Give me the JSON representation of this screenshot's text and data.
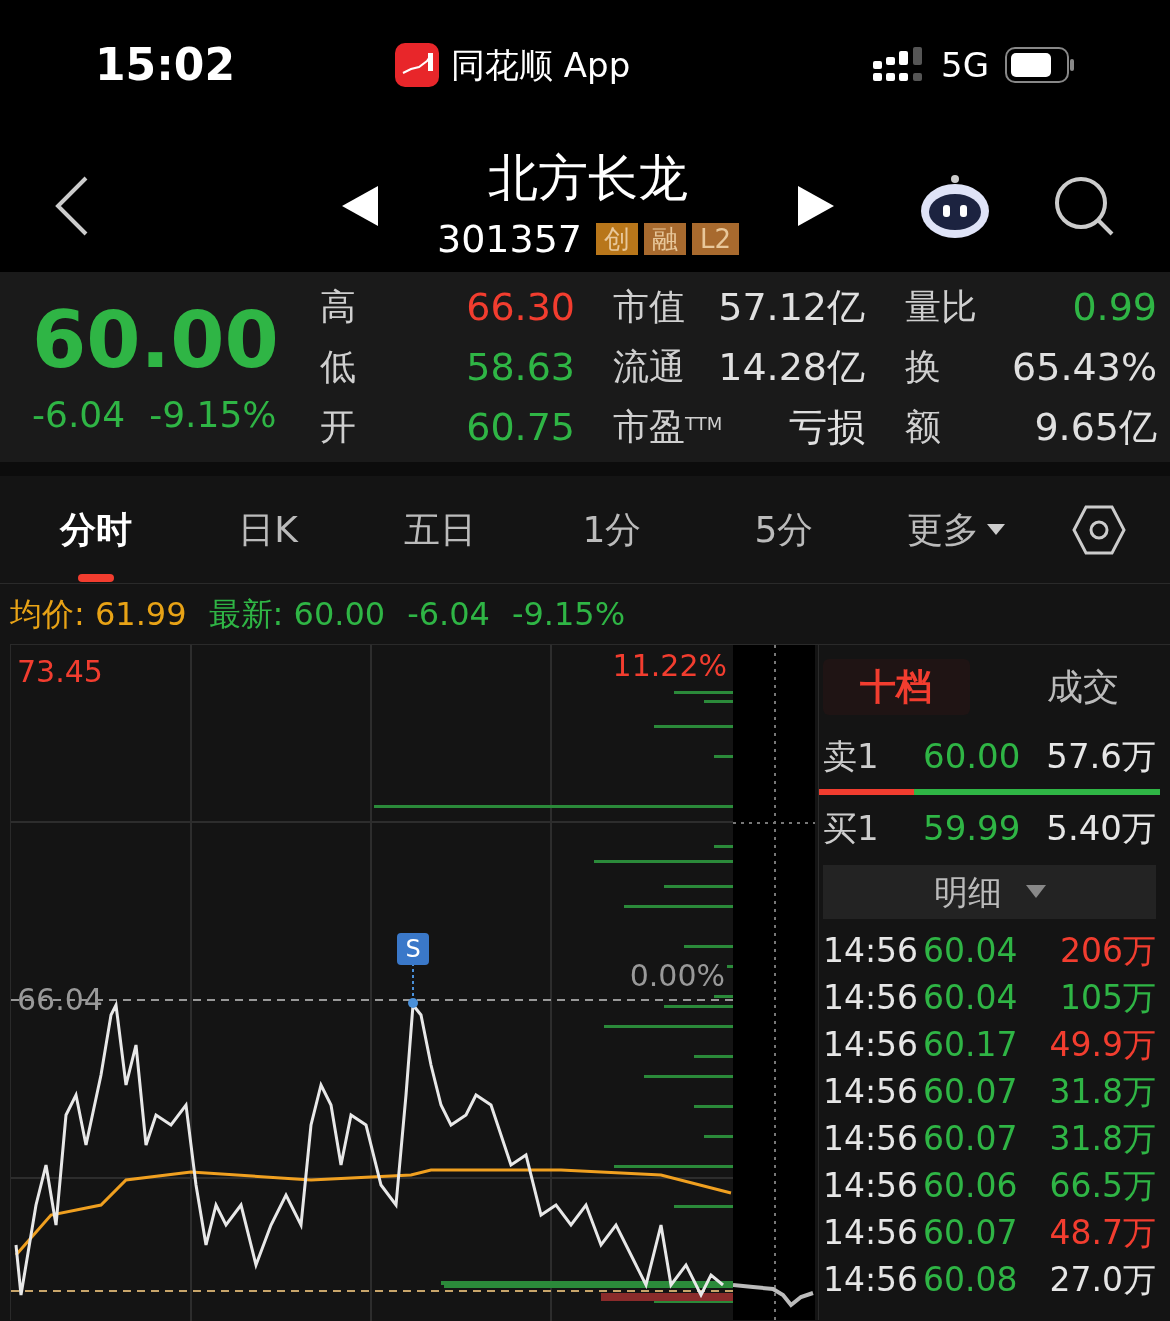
{
  "status_bar": {
    "time": "15:02",
    "app": "同花顺 App",
    "network": "5G"
  },
  "header": {
    "name": "北方长龙",
    "code": "301357",
    "tags": [
      {
        "label": "创",
        "color": "#b8761a"
      },
      {
        "label": "融",
        "color": "#a86a2e"
      },
      {
        "label": "L2",
        "color": "#a86a2e"
      }
    ]
  },
  "quote": {
    "price": "60.00",
    "change": "-6.04",
    "change_pct": "-9.15%",
    "stats": [
      [
        {
          "label": "高",
          "value": "66.30",
          "color": "#f23d2f"
        },
        {
          "label": "市值",
          "value": "57.12亿",
          "color": "#e0e0e0"
        },
        {
          "label": "量比",
          "value": "0.99",
          "color": "#2fb545"
        }
      ],
      [
        {
          "label": "低",
          "value": "58.63",
          "color": "#2fb545"
        },
        {
          "label": "流通",
          "value": "14.28亿",
          "color": "#e0e0e0"
        },
        {
          "label": "换",
          "value": "65.43%",
          "color": "#e0e0e0"
        }
      ],
      [
        {
          "label": "开",
          "value": "60.75",
          "color": "#2fb545"
        },
        {
          "label": "市盈$^{TTM}$",
          "value": "亏损",
          "color": "#e0e0e0"
        },
        {
          "label": "额",
          "value": "9.65亿",
          "color": "#e0e0e0"
        }
      ]
    ]
  },
  "tabs": [
    {
      "label": "分时",
      "selected": true,
      "kind": "tab"
    },
    {
      "label": "日K",
      "selected": false,
      "kind": "tab"
    },
    {
      "label": "五日",
      "selected": false,
      "kind": "tab"
    },
    {
      "label": "1分",
      "selected": false,
      "kind": "tab"
    },
    {
      "label": "5分",
      "selected": false,
      "kind": "tab"
    },
    {
      "label": "更多",
      "selected": false,
      "kind": "menu"
    }
  ],
  "info_line": {
    "avg_label": "均价: 61.99",
    "latest": "最新: 60.00",
    "change": "-6.04",
    "change_pct": "-9.15%"
  },
  "chart": {
    "top_price": "73.45",
    "top_pct": "11.22%",
    "mid_price": "66.04",
    "mid_pct": "0.00%",
    "marker": "S"
  },
  "order_book": {
    "tabs": [
      {
        "label": "十档",
        "selected": true
      },
      {
        "label": "成交",
        "selected": false
      }
    ],
    "levels": [
      {
        "side": "卖1",
        "price": "60.00",
        "volume": "57.6万"
      },
      {
        "side": "买1",
        "price": "59.99",
        "volume": "5.40万"
      }
    ],
    "detail_button": "明细",
    "trades": [
      {
        "time": "14:56",
        "price": "60.04",
        "volume": "206万",
        "color": "#f23d2f"
      },
      {
        "time": "14:56",
        "price": "60.04",
        "volume": "105万",
        "color": "#2fb545"
      },
      {
        "time": "14:56",
        "price": "60.17",
        "volume": "49.9万",
        "color": "#f23d2f"
      },
      {
        "time": "14:56",
        "price": "60.07",
        "volume": "31.8万",
        "color": "#2fb545"
      },
      {
        "time": "14:56",
        "price": "60.07",
        "volume": "31.8万",
        "color": "#2fb545"
      },
      {
        "time": "14:56",
        "price": "60.06",
        "volume": "66.5万",
        "color": "#2fb545"
      },
      {
        "time": "14:56",
        "price": "60.07",
        "volume": "48.7万",
        "color": "#f23d2f"
      },
      {
        "time": "14:56",
        "price": "60.08",
        "volume": "27.0万",
        "color": "#e6e6e6"
      }
    ]
  }
}
